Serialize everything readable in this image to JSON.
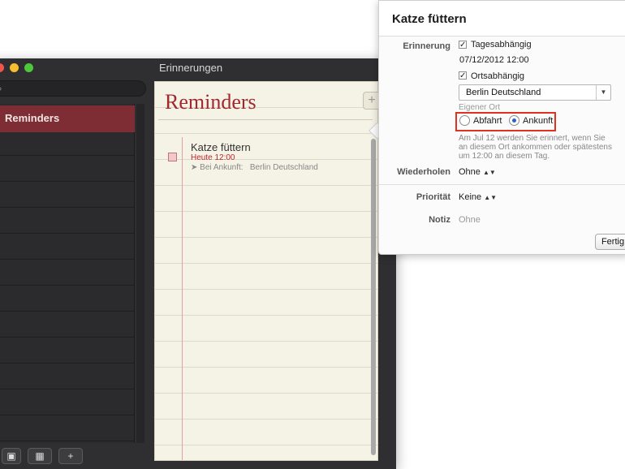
{
  "window": {
    "title": "Erinnerungen",
    "search_placeholder": ""
  },
  "sidebar": {
    "lists": [
      {
        "label": "Reminders",
        "selected": true
      }
    ]
  },
  "bottom_bar": {
    "add_label": "+"
  },
  "list": {
    "title": "Reminders",
    "add_label": "+",
    "items": [
      {
        "title": "Katze füttern",
        "due": "Heute 12:00",
        "location_prefix": "Bei Ankunft:",
        "location": "Berlin Deutschland"
      }
    ]
  },
  "popover": {
    "title": "Katze füttern",
    "remind_label": "Erinnerung",
    "on_day_label": "Tagesabhängig",
    "on_day_checked": true,
    "date_time": "07/12/2012  12:00",
    "at_location_label": "Ortsabhängig",
    "at_location_checked": true,
    "location_value": "Berlin Deutschland",
    "custom_location": "Eigener Ort",
    "leaving_label": "Abfahrt",
    "arriving_label": "Ankunft",
    "selected_trigger": "Ankunft",
    "hint": "Am Jul 12 werden Sie erinnert, wenn Sie an diesem Ort ankommen oder spätestens um 12:00  an diesem Tag.",
    "repeat_label": "Wiederholen",
    "repeat_value": "Ohne",
    "priority_label": "Priorität",
    "priority_value": "Keine",
    "note_label": "Notiz",
    "note_value": "Ohne",
    "done_label": "Fertig"
  },
  "colors": {
    "accent_red": "#a3282e",
    "selection": "#7f2d35",
    "highlight_box": "#e0331f"
  }
}
